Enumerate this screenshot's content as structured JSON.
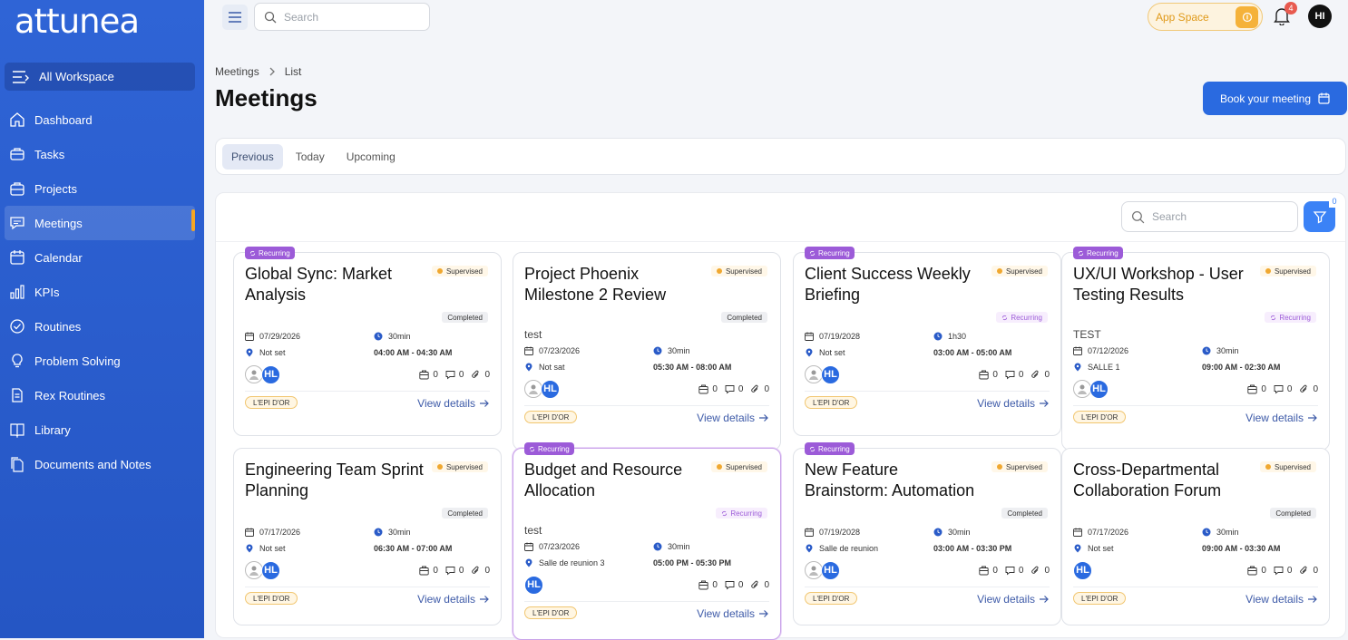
{
  "app": {
    "logo": "attunea"
  },
  "sidebar": {
    "workspace": "All Workspace",
    "items": [
      {
        "label": "Dashboard",
        "icon": "home-icon"
      },
      {
        "label": "Tasks",
        "icon": "briefcase-icon"
      },
      {
        "label": "Projects",
        "icon": "folder-icon"
      },
      {
        "label": "Meetings",
        "icon": "chat-icon",
        "active": true
      },
      {
        "label": "Calendar",
        "icon": "calendar-icon"
      },
      {
        "label": "KPIs",
        "icon": "bar-chart-icon"
      },
      {
        "label": "Routines",
        "icon": "check-circle-icon"
      },
      {
        "label": "Problem Solving",
        "icon": "bulb-icon"
      },
      {
        "label": "Rex Routines",
        "icon": "document-icon"
      },
      {
        "label": "Library",
        "icon": "book-icon"
      },
      {
        "label": "Documents and Notes",
        "icon": "documents-icon"
      }
    ]
  },
  "topbar": {
    "search_placeholder": "Search",
    "app_space": "App Space",
    "notifications": "4",
    "user_initials": "HI"
  },
  "breadcrumb": {
    "first": "Meetings",
    "second": "List"
  },
  "page": {
    "title": "Meetings",
    "book_button": "Book your meeting"
  },
  "tabs": [
    {
      "label": "Previous",
      "active": true
    },
    {
      "label": "Today"
    },
    {
      "label": "Upcoming"
    }
  ],
  "grid": {
    "search_placeholder": "Search",
    "filter_count": "0"
  },
  "labels": {
    "recurring": "Recurring",
    "supervised": "Supervised",
    "view_details": "View details",
    "organization": "L'EPI D'OR"
  },
  "meetings": [
    {
      "title": "Global Sync: Market Analysis",
      "recurring_tag": true,
      "status": "Completed",
      "desc": "",
      "date": "07/29/2026",
      "duration": "30min",
      "location": "Not set",
      "time": "04:00 AM - 04:30 AM",
      "tasks": "0",
      "comments": "0",
      "attachments": "0",
      "extra_avatar": true
    },
    {
      "title": "Project Phoenix Milestone 2 Review",
      "recurring_tag": false,
      "status": "Completed",
      "desc": "test",
      "date": "07/23/2026",
      "duration": "30min",
      "location": "Not sat",
      "time": "05:30 AM - 08:00 AM",
      "tasks": "0",
      "comments": "0",
      "attachments": "0",
      "extra_avatar": true
    },
    {
      "title": "Client Success Weekly Briefing",
      "recurring_tag": true,
      "status": "Recurring",
      "desc": "",
      "date": "07/19/2028",
      "duration": "1h30",
      "location": "Not set",
      "time": "03:00 AM - 05:00 AM",
      "tasks": "0",
      "comments": "0",
      "attachments": "0",
      "extra_avatar": true
    },
    {
      "title": "UX/UI Workshop - User Testing Results",
      "recurring_tag": true,
      "status": "Recurring",
      "desc": "TEST",
      "date": "07/12/2026",
      "duration": "30min",
      "location": "SALLE 1",
      "time": "09:00 AM - 02:30 AM",
      "tasks": "0",
      "comments": "0",
      "attachments": "0",
      "extra_avatar": true
    },
    {
      "title": "Engineering Team Sprint Planning",
      "recurring_tag": false,
      "status": "Completed",
      "desc": "",
      "date": "07/17/2026",
      "duration": "30min",
      "location": "Not set",
      "time": "06:30 AM - 07:00 AM",
      "tasks": "0",
      "comments": "0",
      "attachments": "0",
      "extra_avatar": true
    },
    {
      "title": "Budget and Resource Allocation",
      "recurring_tag": true,
      "status": "Recurring",
      "desc": "test",
      "date": "07/23/2026",
      "duration": "30min",
      "location": "Salle de reunion 3",
      "time": "05:00 PM - 05:30 PM",
      "tasks": "0",
      "comments": "0",
      "attachments": "0",
      "extra_avatar": false
    },
    {
      "title": "New Feature Brainstorm: Automation",
      "recurring_tag": true,
      "status": "Completed",
      "desc": "",
      "date": "07/19/2028",
      "duration": "30min",
      "location": "Salle de reunion",
      "time": "03:00 AM - 03:30 PM",
      "tasks": "0",
      "comments": "0",
      "attachments": "0",
      "extra_avatar": true
    },
    {
      "title": "Cross-Departmental Collaboration Forum",
      "recurring_tag": false,
      "status": "Completed",
      "desc": "",
      "date": "07/17/2026",
      "duration": "30min",
      "location": "Not set",
      "time": "09:00 AM - 03:30 AM",
      "tasks": "0",
      "comments": "0",
      "attachments": "0",
      "extra_avatar": false
    }
  ],
  "avatar_initials": "HL",
  "colors": {
    "sidebar": "#2f64d6",
    "accent": "#2a6ae0",
    "recurring": "#9c5bd8",
    "supervised_dot": "#f0a830"
  }
}
